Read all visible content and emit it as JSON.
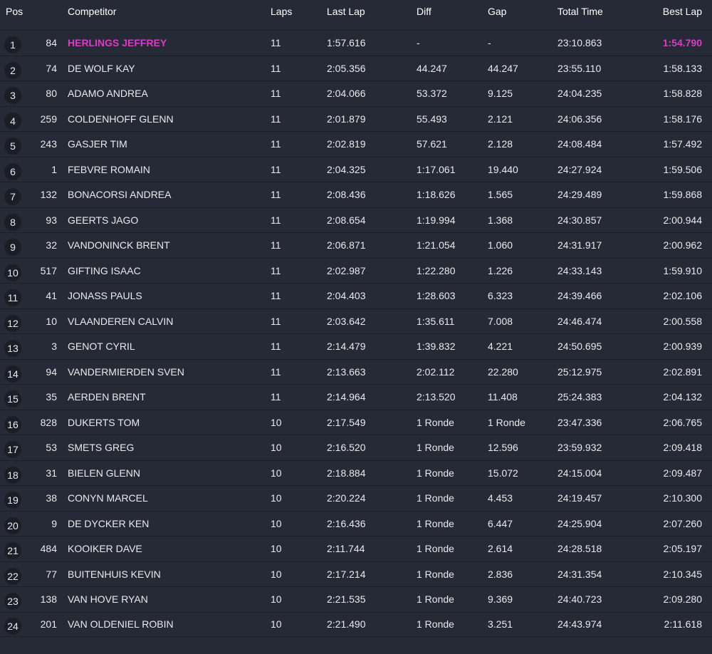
{
  "columns": {
    "pos": "Pos",
    "competitor": "Competitor",
    "laps": "Laps",
    "last_lap": "Last Lap",
    "diff": "Diff",
    "gap": "Gap",
    "total_time": "Total Time",
    "best_lap": "Best Lap"
  },
  "colors": {
    "background": "#262a36",
    "highlight": "#d43fc4",
    "text": "#e9eaee"
  },
  "rows": [
    {
      "pos": "1",
      "num": "84",
      "name": "HERLINGS JEFFREY",
      "laps": "11",
      "last": "1:57.616",
      "diff": "-",
      "gap": "-",
      "total": "23:10.863",
      "best": "1:54.790",
      "highlight": true
    },
    {
      "pos": "2",
      "num": "74",
      "name": "DE WOLF KAY",
      "laps": "11",
      "last": "2:05.356",
      "diff": "44.247",
      "gap": "44.247",
      "total": "23:55.110",
      "best": "1:58.133"
    },
    {
      "pos": "3",
      "num": "80",
      "name": "ADAMO ANDREA",
      "laps": "11",
      "last": "2:04.066",
      "diff": "53.372",
      "gap": "9.125",
      "total": "24:04.235",
      "best": "1:58.828"
    },
    {
      "pos": "4",
      "num": "259",
      "name": "COLDENHOFF GLENN",
      "laps": "11",
      "last": "2:01.879",
      "diff": "55.493",
      "gap": "2.121",
      "total": "24:06.356",
      "best": "1:58.176"
    },
    {
      "pos": "5",
      "num": "243",
      "name": "GASJER TIM",
      "laps": "11",
      "last": "2:02.819",
      "diff": "57.621",
      "gap": "2.128",
      "total": "24:08.484",
      "best": "1:57.492"
    },
    {
      "pos": "6",
      "num": "1",
      "name": "FEBVRE ROMAIN",
      "laps": "11",
      "last": "2:04.325",
      "diff": "1:17.061",
      "gap": "19.440",
      "total": "24:27.924",
      "best": "1:59.506"
    },
    {
      "pos": "7",
      "num": "132",
      "name": "BONACORSI ANDREA",
      "laps": "11",
      "last": "2:08.436",
      "diff": "1:18.626",
      "gap": "1.565",
      "total": "24:29.489",
      "best": "1:59.868"
    },
    {
      "pos": "8",
      "num": "93",
      "name": "GEERTS JAGO",
      "laps": "11",
      "last": "2:08.654",
      "diff": "1:19.994",
      "gap": "1.368",
      "total": "24:30.857",
      "best": "2:00.944"
    },
    {
      "pos": "9",
      "num": "32",
      "name": "VANDONINCK BRENT",
      "laps": "11",
      "last": "2:06.871",
      "diff": "1:21.054",
      "gap": "1.060",
      "total": "24:31.917",
      "best": "2:00.962"
    },
    {
      "pos": "10",
      "num": "517",
      "name": "GIFTING ISAAC",
      "laps": "11",
      "last": "2:02.987",
      "diff": "1:22.280",
      "gap": "1.226",
      "total": "24:33.143",
      "best": "1:59.910"
    },
    {
      "pos": "11",
      "num": "41",
      "name": "JONASS PAULS",
      "laps": "11",
      "last": "2:04.403",
      "diff": "1:28.603",
      "gap": "6.323",
      "total": "24:39.466",
      "best": "2:02.106"
    },
    {
      "pos": "12",
      "num": "10",
      "name": "VLAANDEREN CALVIN",
      "laps": "11",
      "last": "2:03.642",
      "diff": "1:35.611",
      "gap": "7.008",
      "total": "24:46.474",
      "best": "2:00.558"
    },
    {
      "pos": "13",
      "num": "3",
      "name": "GENOT CYRIL",
      "laps": "11",
      "last": "2:14.479",
      "diff": "1:39.832",
      "gap": "4.221",
      "total": "24:50.695",
      "best": "2:00.939"
    },
    {
      "pos": "14",
      "num": "94",
      "name": "VANDERMIERDEN SVEN",
      "laps": "11",
      "last": "2:13.663",
      "diff": "2:02.112",
      "gap": "22.280",
      "total": "25:12.975",
      "best": "2:02.891"
    },
    {
      "pos": "15",
      "num": "35",
      "name": "AERDEN BRENT",
      "laps": "11",
      "last": "2:14.964",
      "diff": "2:13.520",
      "gap": "11.408",
      "total": "25:24.383",
      "best": "2:04.132"
    },
    {
      "pos": "16",
      "num": "828",
      "name": "DUKERTS TOM",
      "laps": "10",
      "last": "2:17.549",
      "diff": "1 Ronde",
      "gap": "1 Ronde",
      "total": "23:47.336",
      "best": "2:06.765"
    },
    {
      "pos": "17",
      "num": "53",
      "name": "SMETS GREG",
      "laps": "10",
      "last": "2:16.520",
      "diff": "1 Ronde",
      "gap": "12.596",
      "total": "23:59.932",
      "best": "2:09.418"
    },
    {
      "pos": "18",
      "num": "31",
      "name": "BIELEN GLENN",
      "laps": "10",
      "last": "2:18.884",
      "diff": "1 Ronde",
      "gap": "15.072",
      "total": "24:15.004",
      "best": "2:09.487"
    },
    {
      "pos": "19",
      "num": "38",
      "name": "CONYN MARCEL",
      "laps": "10",
      "last": "2:20.224",
      "diff": "1 Ronde",
      "gap": "4.453",
      "total": "24:19.457",
      "best": "2:10.300"
    },
    {
      "pos": "20",
      "num": "9",
      "name": "DE DYCKER KEN",
      "laps": "10",
      "last": "2:16.436",
      "diff": "1 Ronde",
      "gap": "6.447",
      "total": "24:25.904",
      "best": "2:07.260"
    },
    {
      "pos": "21",
      "num": "484",
      "name": "KOOIKER DAVE",
      "laps": "10",
      "last": "2:11.744",
      "diff": "1 Ronde",
      "gap": "2.614",
      "total": "24:28.518",
      "best": "2:05.197"
    },
    {
      "pos": "22",
      "num": "77",
      "name": "BUITENHUIS KEVIN",
      "laps": "10",
      "last": "2:17.214",
      "diff": "1 Ronde",
      "gap": "2.836",
      "total": "24:31.354",
      "best": "2:10.345"
    },
    {
      "pos": "23",
      "num": "138",
      "name": "VAN HOVE RYAN",
      "laps": "10",
      "last": "2:21.535",
      "diff": "1 Ronde",
      "gap": "9.369",
      "total": "24:40.723",
      "best": "2:09.280"
    },
    {
      "pos": "24",
      "num": "201",
      "name": "VAN OLDENIEL ROBIN",
      "laps": "10",
      "last": "2:21.490",
      "diff": "1 Ronde",
      "gap": "3.251",
      "total": "24:43.974",
      "best": "2:11.618"
    }
  ]
}
